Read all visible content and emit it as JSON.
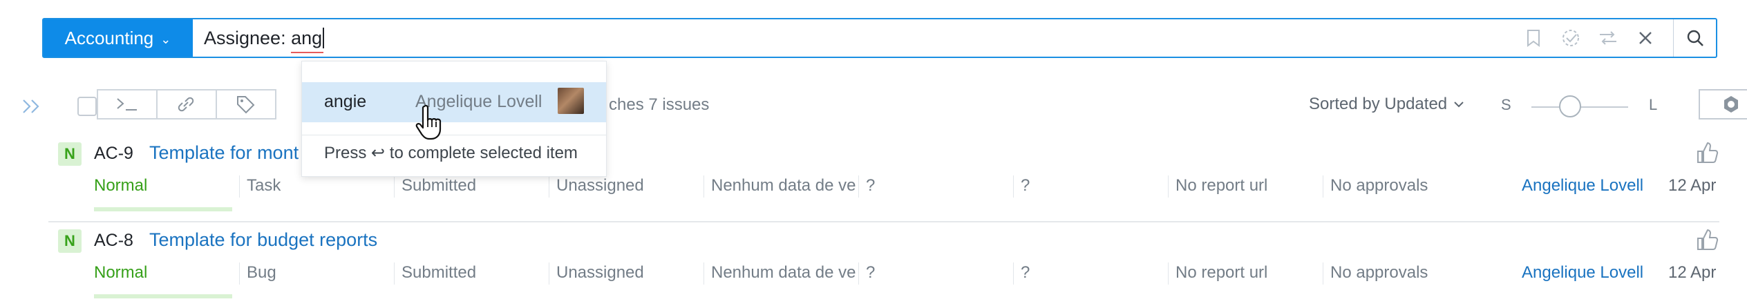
{
  "search": {
    "project": "Accounting",
    "query_prefix": "Assignee: ",
    "query_typed": "ang"
  },
  "suggestion": {
    "login": "angie",
    "full_name": "Angelique Lovell",
    "hint": "Press ↩ to complete selected item"
  },
  "toolbar": {
    "matches_text": "ches 7 issues",
    "sort_label": "Sorted by Updated",
    "size_small": "S",
    "size_large": "L"
  },
  "issues": [
    {
      "priority_badge": "N",
      "id": "AC-9",
      "summary": "Template for mont",
      "priority": "Normal",
      "type": "Task",
      "state": "Submitted",
      "subsystem": "Unassigned",
      "due": "Nenhum data de ve",
      "field1": "?",
      "field2": "?",
      "report_url": "No report url",
      "approvals": "No approvals",
      "assignee": "Angelique Lovell",
      "updated": "12 Apr"
    },
    {
      "priority_badge": "N",
      "id": "AC-8",
      "summary": "Template for budget reports",
      "priority": "Normal",
      "type": "Bug",
      "state": "Submitted",
      "subsystem": "Unassigned",
      "due": "Nenhum data de ve",
      "field1": "?",
      "field2": "?",
      "report_url": "No report url",
      "approvals": "No approvals",
      "assignee": "Angelique Lovell",
      "updated": "12 Apr"
    }
  ],
  "colors": {
    "accent": "#0e8be8",
    "link": "#1a73c0",
    "priority_normal": "#36a019",
    "highlight": "#d6e9f9"
  }
}
